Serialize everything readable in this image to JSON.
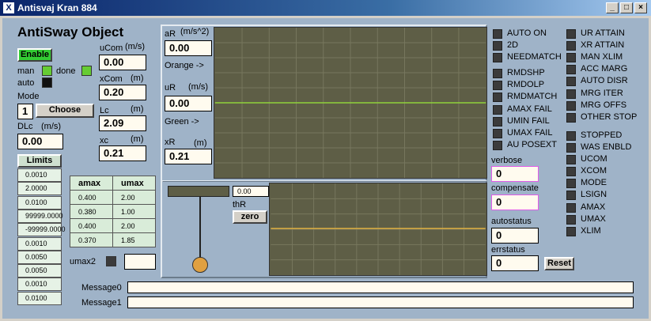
{
  "window": {
    "title": "Antisvaj Kran 884",
    "app_icon": "X"
  },
  "header": {
    "title": "AntiSway Object",
    "enable_label": "Enable"
  },
  "mode": {
    "man_label": "man",
    "done_label": "done",
    "auto_label": "auto",
    "mode_label": "Mode",
    "mode_value": "1",
    "choose_label": "Choose",
    "dlc_label": "DLc",
    "dlc_unit": "(m/s)",
    "dlc_value": "0.00"
  },
  "vars": {
    "ucom_label": "uCom",
    "ucom_unit": "(m/s)",
    "ucom_value": "0.00",
    "xcom_label": "xCom",
    "xcom_unit": "(m)",
    "xcom_value": "0.20",
    "lc_label": "Lc",
    "lc_unit": "(m)",
    "lc_value": "2.09",
    "xc_label": "xc",
    "xc_unit": "(m)",
    "xc_value": "0.21"
  },
  "limits": {
    "label": "Limits",
    "values": [
      "0.0010",
      "2.0000",
      "0.0100",
      "99999.0000",
      "-99999.0000",
      "0.0010",
      "0.0050",
      "0.0050",
      "0.0010",
      "0.0100"
    ]
  },
  "amax_table": {
    "headers": [
      "amax",
      "umax"
    ],
    "rows": [
      [
        "0.400",
        "2.00"
      ],
      [
        "0.380",
        "1.00"
      ],
      [
        "0.400",
        "2.00"
      ],
      [
        "0.370",
        "1.85"
      ]
    ]
  },
  "umax2": {
    "label": "umax2",
    "value": ""
  },
  "plot": {
    "ar_label": "aR",
    "ar_unit": "(m/s^2)",
    "ar_value": "0.00",
    "orange_label": "Orange ->",
    "ur_label": "uR",
    "ur_unit": "(m/s)",
    "ur_value": "0.00",
    "green_label": "Green ->",
    "xr_label": "xR",
    "xr_unit": "(m)",
    "xr_value": "0.21",
    "thr_value": "0.00",
    "thr_label": "thR",
    "zero_label": "zero"
  },
  "status_col1": [
    "AUTO ON",
    "2D",
    "NEEDMATCH",
    "RMDSHP",
    "RMDOLP",
    "RMDMATCH",
    "AMAX FAIL",
    "UMIN FAIL",
    "UMAX FAIL",
    "AU POSEXT"
  ],
  "status_col2": [
    "UR ATTAIN",
    "XR ATTAIN",
    "MAN XLIM",
    "ACC MARG",
    "AUTO DISR",
    "MRG ITER",
    "MRG OFFS",
    "OTHER STOP",
    "STOPPED",
    "WAS ENBLD",
    "UCOM",
    "XCOM",
    "MODE",
    "LSIGN",
    "AMAX",
    "UMAX",
    "XLIM"
  ],
  "fields": {
    "verbose_label": "verbose",
    "verbose_value": "0",
    "compensate_label": "compensate",
    "compensate_value": "0",
    "autostatus_label": "autostatus",
    "autostatus_value": "0",
    "errstatus_label": "errstatus",
    "errstatus_value": "0",
    "reset_label": "Reset"
  },
  "messages": {
    "msg0_label": "Message0",
    "msg0_value": "",
    "msg1_label": "Message1",
    "msg1_value": ""
  },
  "colors": {
    "accent": "#0a246a",
    "enable": "#33cc33",
    "plot_bg": "#5e5e46",
    "green_line": "#8fd23a",
    "orange_line": "#e0b040",
    "led": "#3b3b3b"
  }
}
